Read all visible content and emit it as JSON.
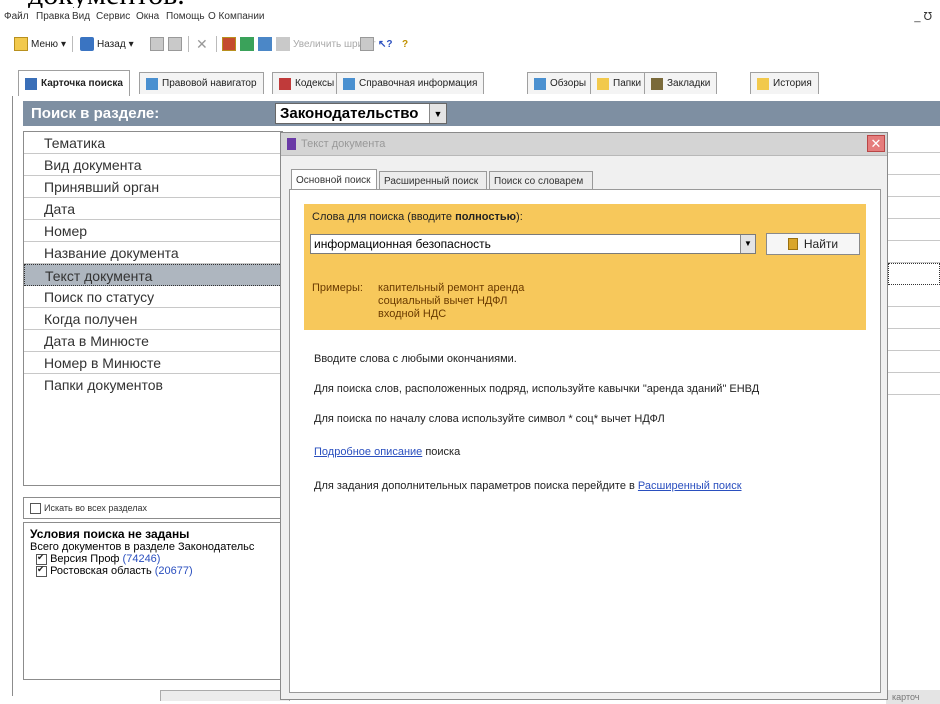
{
  "top_fragment": "документов.",
  "menubar": {
    "items": [
      "Файл",
      "Правка",
      "Вид",
      "Сервис",
      "Окна",
      "Помощь",
      "О Компании"
    ],
    "window_controls": "_ ℧"
  },
  "toolbar": {
    "menu_label": "Меню",
    "back_label": "Назад",
    "font_label": "Увеличить шрифт"
  },
  "tabs": [
    {
      "label": "Карточка поиска"
    },
    {
      "label": "Правовой навигатор"
    },
    {
      "label": "Кодексы"
    },
    {
      "label": "Справочная информация"
    },
    {
      "label": "Обзоры"
    },
    {
      "label": "Папки"
    },
    {
      "label": "Закладки"
    },
    {
      "label": "История"
    }
  ],
  "search_header": {
    "label": "Поиск в разделе:",
    "section_value": "Законодательство"
  },
  "fields": [
    "Тематика",
    "Вид документа",
    "Принявший орган",
    "Дата",
    "Номер",
    "Название документа",
    "Текст документа",
    "Поиск по статусу",
    "Когда получен",
    "Дата в Минюсте",
    "Номер в Минюсте",
    "Папки документов"
  ],
  "selected_field": "Текст документа",
  "search_all": {
    "label": "Искать во всех разделах",
    "checked": false
  },
  "conditions": {
    "title": "Условия поиска не заданы",
    "total_line": "Всего документов в разделе Законодательс",
    "items": [
      {
        "name": "Версия Проф",
        "count": "(74246)",
        "checked": true
      },
      {
        "name": "Ростовская область",
        "count": "(20677)",
        "checked": true
      }
    ]
  },
  "right_status": "карточ",
  "dialog": {
    "title": "Текст документа",
    "tabs": [
      "Основной поиск",
      "Расширенный поиск",
      "Поиск со словарем"
    ],
    "active_tab": "Основной поиск",
    "search_label_prefix": "Слова для поиска (вводите ",
    "search_label_bold": "полностью",
    "search_label_suffix": "):",
    "search_value": "информационная безопасность",
    "find_button": "Найти",
    "examples_label": "Примеры:",
    "examples": [
      "капительный ремонт аренда",
      "социальный вычет НДФЛ",
      "входной НДС"
    ],
    "hint1": "Вводите слова с любыми окончаниями.",
    "hint2": "Для поиска слов, расположенных подряд, используйте кавычки \"аренда зданий\" ЕНВД",
    "hint3": "Для поиска по началу слова используйте символ * соц* вычет НДФЛ",
    "details_link": "Подробное описание",
    "details_suffix": " поиска",
    "ext_prefix": "Для задания дополнительных параметров поиска перейдите в ",
    "ext_link": "Расширенный поиск"
  }
}
